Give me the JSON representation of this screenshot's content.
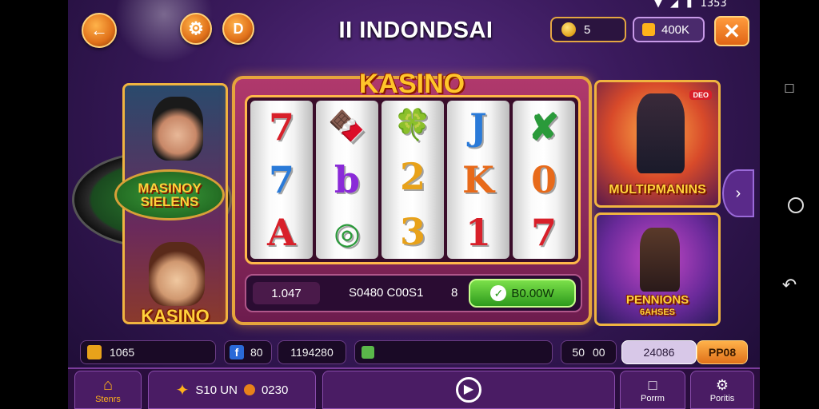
{
  "status_bar": {
    "time": "1353"
  },
  "header": {
    "title": "II INDONDSAI",
    "coins_value": "5",
    "bonus_value": "400K"
  },
  "machine": {
    "logo": "KASINO",
    "reels": [
      [
        "7",
        "7",
        "A"
      ],
      [
        "🍫",
        "b",
        "◎"
      ],
      [
        "🍀",
        "2",
        "3"
      ],
      [
        "J",
        "K",
        "1"
      ],
      [
        "✘",
        "0",
        "7"
      ]
    ],
    "credit": "1.047",
    "bet_text": "S0480 C00S1",
    "lines": "8",
    "spin_label": "B0.00W"
  },
  "left_panel": {
    "badge": "MASINOY SIELENS",
    "label": "KASINO"
  },
  "right_panel": {
    "top_badge": "DEO",
    "top_label": "MULTIPMANINS",
    "bottom_label_1": "PENNIONS",
    "bottom_label_2": "6AHSES"
  },
  "info_row": {
    "item1": "1065",
    "item2": "80",
    "item3": "1194280",
    "item4": "50",
    "item4b": "00",
    "item5": "24086",
    "item6": "PP08"
  },
  "tabs": {
    "home": "Stenrs",
    "promo_text": "S10 UN",
    "promo_value": "0230",
    "profile": "Porrm",
    "settings": "Poritis"
  },
  "colors": {
    "accent": "#f0b440",
    "spin_green": "#2d9a1c",
    "bg": "#3a1a5c"
  }
}
